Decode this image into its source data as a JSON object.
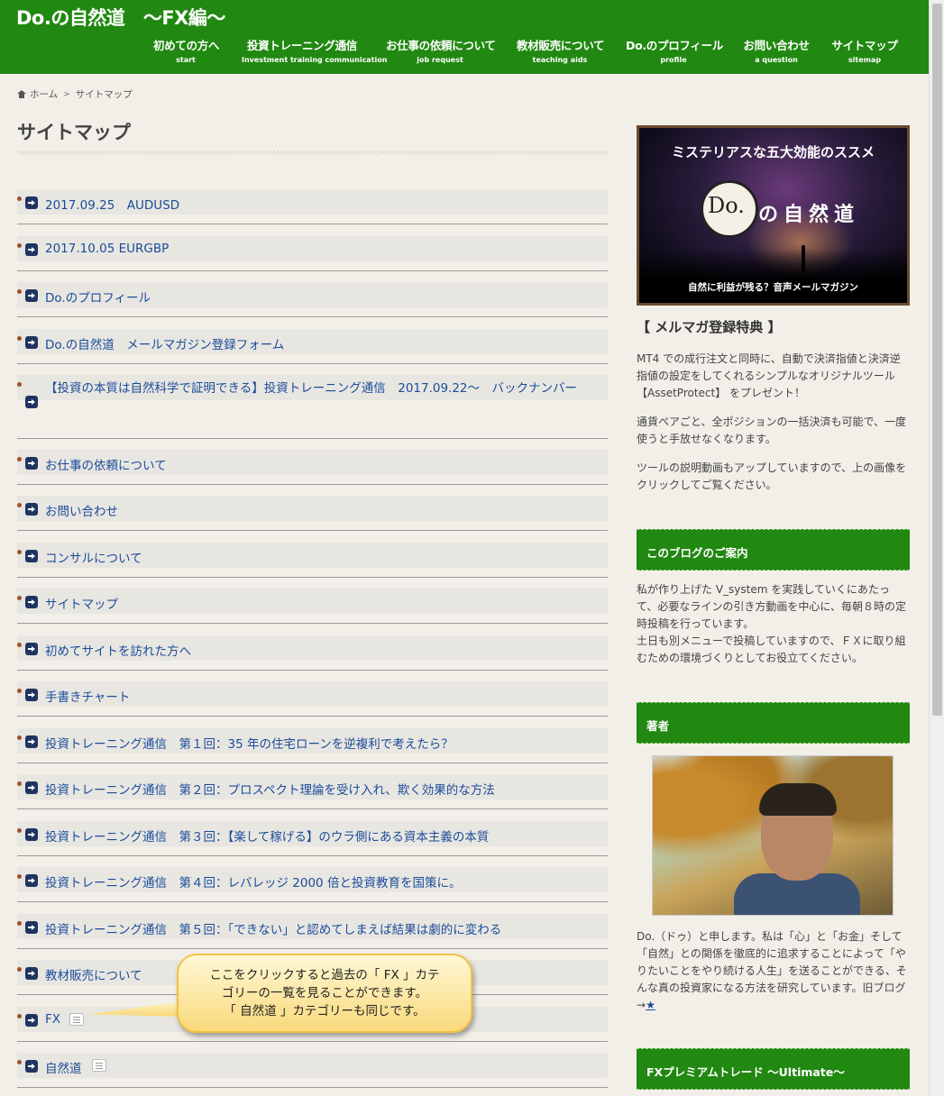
{
  "site": {
    "title": "Do.の自然道　～FX編～"
  },
  "nav": [
    {
      "jp": "初めての方へ",
      "en": "start"
    },
    {
      "jp": "投資トレーニング通信",
      "en": "Investment training communication"
    },
    {
      "jp": "お仕事の依頼について",
      "en": "job request"
    },
    {
      "jp": "教材販売について",
      "en": "teaching aids"
    },
    {
      "jp": "Do.のプロフィール",
      "en": "profile"
    },
    {
      "jp": "お問い合わせ",
      "en": "a question"
    },
    {
      "jp": "サイトマップ",
      "en": "sitemap"
    }
  ],
  "breadcrumb": {
    "home": "ホーム",
    "separator": ">",
    "current": "サイトマップ"
  },
  "page": {
    "title": "サイトマップ"
  },
  "sitemap": [
    "2017.09.25　AUDUSD",
    "2017.10.05 EURGBP",
    "Do.のプロフィール",
    "Do.の自然道　メールマガジン登録フォーム",
    "【投資の本質は自然科学で証明できる】投資トレーニング通信　2017.09.22～　バックナンバー",
    "お仕事の依頼について",
    "お問い合わせ",
    "コンサルについて",
    "サイトマップ",
    "初めてサイトを訪れた方へ",
    "手書きチャート",
    "投資トレーニング通信　第１回：35 年の住宅ローンを逆複利で考えたら？",
    "投資トレーニング通信　第２回：プロスペクト理論を受け入れ、欺く効果的な方法",
    "投資トレーニング通信　第３回：【楽して稼げる】のウラ側にある資本主義の本質",
    "投資トレーニング通信　第４回：レバレッジ 2000 倍と投資教育を国策に。",
    "投資トレーニング通信　第５回：「できない」と認めてしまえば結果は劇的に変わる",
    "教材販売について"
  ],
  "categories": [
    "FX",
    "自然道"
  ],
  "callout": {
    "line1": "ここをクリックすると過去の「 FX 」カテ",
    "line2": "ゴリーの一覧を見ることができます。",
    "line3": "「 自然道 」カテゴリーも同じです。"
  },
  "sidebar": {
    "banner": {
      "headline": "ミステリアスな五大効能のススメ",
      "logo_do": "Do.",
      "logo_name": "の自然道",
      "footer": "自然に利益が残る？音声メールマガジン"
    },
    "melmaga_heading": "【 メルマガ登録特典 】",
    "melmaga_p1": "MT4 での成行注文と同時に、自動で決済指値と決済逆指値の設定をしてくれるシンプルなオリジナルツール 【AssetProtect】 をプレゼント！",
    "melmaga_p2": "通貨ペアごと、全ポジションの一括決済も可能で、一度使うと手放せなくなります。",
    "melmaga_p3": "ツールの説明動画もアップしていますので、上の画像をクリックしてご覧ください。",
    "blog_heading": "このブログのご案内",
    "blog_text": "私が作り上げた V_system を実践していくにあたって、必要なラインの引き方動画を中心に、毎朝８時の定時投稿を行っています。\n土日も別メニューで投稿していますので、ＦＸに取り組むための環境づくりとしてお役立てください。",
    "author_heading": "著者",
    "author_text": "Do.（ドゥ）と申します。私は「心」と「お金」そして「自然」との関係を徹底的に追求することによって「やりたいことをやり続ける人生」を送ることができる、そんな真の投資家になる方法を研究しています。旧ブログ→",
    "author_link": "★",
    "premium_heading": "FXプレミアムトレード ～Ultimate～"
  }
}
